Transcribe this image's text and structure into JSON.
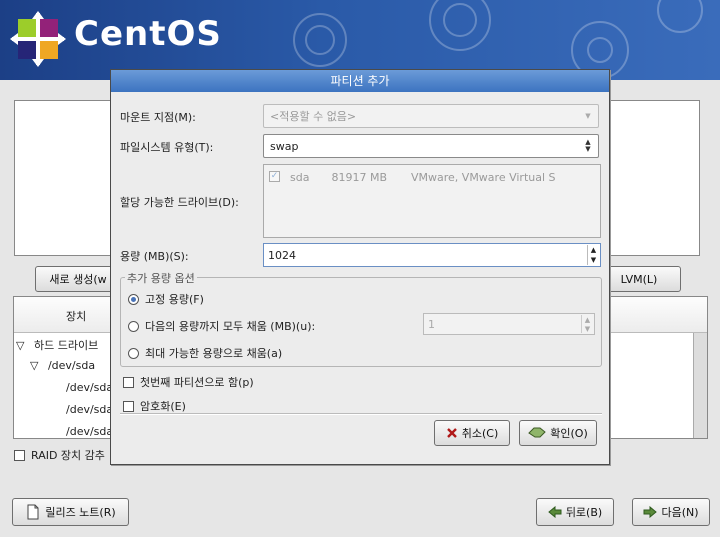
{
  "app": {
    "logo_text": "CentOS"
  },
  "dialog": {
    "title": "파티션 추가",
    "mount_label": "마운트 지점(M):",
    "mount_placeholder": "<적용할 수 없음>",
    "fs_label": "파일시스템 유형(T):",
    "fs_value": "swap",
    "drives_label": "할당 가능한 드라이브(D):",
    "drive": {
      "name": "sda",
      "size": "81917 MB",
      "model": "VMware, VMware Virtual S"
    },
    "size_label": "용량 (MB)(S):",
    "size_value": "1024",
    "options_legend": "추가 용량 옵션",
    "opt_fixed": "고정 용량(F)",
    "opt_fill_upto": "다음의 용량까지 모두 채움 (MB)(u):",
    "fill_upto_value": "1",
    "opt_fill_max": "최대 가능한 용량으로 채움(a)",
    "primary_label": "첫번째 파티션으로 함(p)",
    "encrypt_label": "암호화(E)",
    "cancel": "취소(C)",
    "ok": "확인(O)"
  },
  "background": {
    "new_button": "새로 생성(w",
    "lvm_button": "LVM(L)",
    "col_device": "장치",
    "tree": [
      "하드 드라이브",
      "/dev/sda",
      "/dev/sda",
      "/dev/sda",
      "/dev/sda"
    ],
    "raid_label": "RAID 장치 감추",
    "release_notes": "릴리즈 노트(R)",
    "back": "뒤로(B)",
    "next": "다음(N)"
  },
  "colors": {
    "banner": "#2a5aa8",
    "title_bar": "#4a7fc6",
    "accent": "#4a74b8"
  }
}
